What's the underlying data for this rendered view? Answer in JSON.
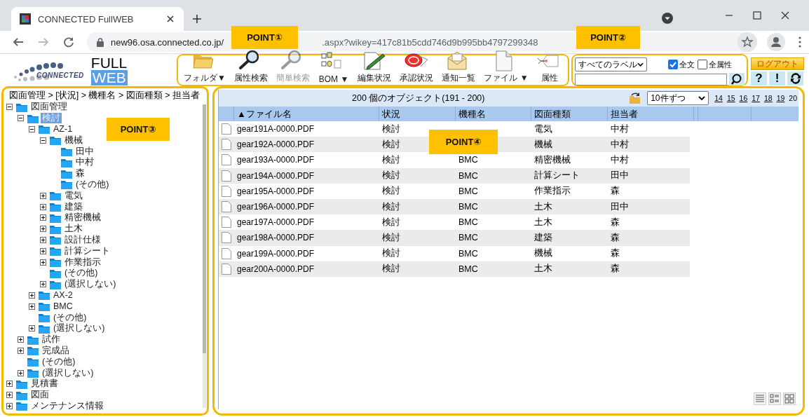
{
  "browser": {
    "tab_title": "CONNECTED FullWEB",
    "url_start": "new96.osa.connected.co.jp/",
    "url_end": ".aspx?wikey=417c81b5cdd746d9b995bb4797299348"
  },
  "callouts": [
    {
      "label": "POINT①",
      "kind": "toolbar"
    },
    {
      "label": "POINT②",
      "kind": "search"
    },
    {
      "label": "POINT③",
      "kind": "tree"
    },
    {
      "label": "POINT④",
      "kind": "list"
    }
  ],
  "logo": {
    "company": "CONNECTED",
    "product_top": "FULL",
    "product_bottom": "WEB"
  },
  "toolbar": [
    {
      "label": "フォルダ▼",
      "kind": "folder",
      "disabled": false
    },
    {
      "label": "属性検索",
      "kind": "magnifier",
      "disabled": false
    },
    {
      "label": "簡単検索",
      "kind": "magnifier",
      "disabled": true
    },
    {
      "label": "BOM ▼",
      "kind": "bom",
      "disabled": false
    },
    {
      "label": "編集状況",
      "kind": "pencil",
      "disabled": false
    },
    {
      "label": "承認状況",
      "kind": "stamp",
      "disabled": false
    },
    {
      "label": "通知一覧",
      "kind": "envelope",
      "disabled": false
    },
    {
      "label": "ファイル ▼",
      "kind": "document",
      "disabled": false
    },
    {
      "label": "属性",
      "kind": "tag",
      "disabled": false
    }
  ],
  "search": {
    "label_select": "すべてのラベル",
    "options": [
      {
        "label": "全文",
        "checked": true
      },
      {
        "label": "全属性",
        "checked": false
      }
    ]
  },
  "session": {
    "logout": "ログアウト",
    "help": "?",
    "notice": "!"
  },
  "tree": {
    "breadcrumb": "図面管理 > [状況] > 機種名 > 図面種類 > 担当者",
    "items": [
      {
        "kind": "folder",
        "label": "図面管理",
        "expanded": true,
        "selected": false,
        "children": [
          {
            "kind": "folder",
            "label": "検討",
            "expanded": true,
            "selected": true,
            "children": [
              {
                "kind": "folder",
                "label": "AZ-1",
                "expanded": true,
                "selected": false,
                "children": [
                  {
                    "kind": "folder",
                    "label": "機械",
                    "expanded": true,
                    "selected": false,
                    "children": [
                      {
                        "kind": "leaf",
                        "label": "田中",
                        "selected": false
                      },
                      {
                        "kind": "leaf",
                        "label": "中村",
                        "selected": false
                      },
                      {
                        "kind": "leaf",
                        "label": "森",
                        "selected": false
                      },
                      {
                        "kind": "leaf",
                        "label": "(その他)",
                        "selected": false
                      }
                    ]
                  },
                  {
                    "kind": "folder",
                    "label": "電気",
                    "expanded": false,
                    "selected": false
                  },
                  {
                    "kind": "folder",
                    "label": "建築",
                    "expanded": false,
                    "selected": false
                  },
                  {
                    "kind": "folder",
                    "label": "精密機械",
                    "expanded": false,
                    "selected": false
                  },
                  {
                    "kind": "folder",
                    "label": "土木",
                    "expanded": false,
                    "selected": false
                  },
                  {
                    "kind": "folder",
                    "label": "設計仕様",
                    "expanded": false,
                    "selected": false
                  },
                  {
                    "kind": "folder",
                    "label": "計算シート",
                    "expanded": false,
                    "selected": false
                  },
                  {
                    "kind": "folder",
                    "label": "作業指示",
                    "expanded": false,
                    "selected": false
                  },
                  {
                    "kind": "leaf",
                    "label": "(その他)",
                    "selected": false
                  },
                  {
                    "kind": "folder",
                    "label": "(選択しない)",
                    "expanded": false,
                    "selected": false
                  }
                ]
              },
              {
                "kind": "folder",
                "label": "AX-2",
                "expanded": false,
                "selected": false
              },
              {
                "kind": "folder",
                "label": "BMC",
                "expanded": false,
                "selected": false
              },
              {
                "kind": "leaf",
                "label": "(その他)",
                "selected": false
              },
              {
                "kind": "folder",
                "label": "(選択しない)",
                "expanded": false,
                "selected": false
              }
            ]
          },
          {
            "kind": "folder",
            "label": "試作",
            "expanded": false,
            "selected": false
          },
          {
            "kind": "folder",
            "label": "完成品",
            "expanded": false,
            "selected": false
          },
          {
            "kind": "leaf",
            "label": "(その他)",
            "selected": false
          },
          {
            "kind": "folder",
            "label": "(選択しない)",
            "expanded": false,
            "selected": false
          }
        ]
      },
      {
        "kind": "folder",
        "label": "見積書",
        "expanded": false,
        "selected": false
      },
      {
        "kind": "folder",
        "label": "図面",
        "expanded": false,
        "selected": false
      },
      {
        "kind": "folder",
        "label": "メンテナンス情報",
        "expanded": false,
        "selected": false
      }
    ]
  },
  "list": {
    "summary": "200 個のオブジェクト(191 - 200)",
    "page_size": "10件ずつ",
    "pages": [
      {
        "label": "14",
        "selected": false
      },
      {
        "label": "15",
        "selected": false
      },
      {
        "label": "16",
        "selected": false
      },
      {
        "label": "17",
        "selected": false
      },
      {
        "label": "18",
        "selected": false
      },
      {
        "label": "19",
        "selected": false
      },
      {
        "label": "20",
        "selected": true
      }
    ],
    "columns": [
      "▲ファイル名",
      "状況",
      "機種名",
      "図面種類",
      "担当者"
    ],
    "rows": [
      {
        "file": "gear191A-0000.PDF",
        "status": "検討",
        "type": "電気",
        "person": "中村"
      },
      {
        "file": "gear192A-0000.PDF",
        "status": "検討",
        "type": "機械",
        "person": "中村"
      },
      {
        "file": "gear193A-0000.PDF",
        "status": "検討",
        "model": "BMC",
        "type": "精密機械",
        "person": "中村"
      },
      {
        "file": "gear194A-0000.PDF",
        "status": "検討",
        "model": "BMC",
        "type": "計算シート",
        "person": "田中"
      },
      {
        "file": "gear195A-0000.PDF",
        "status": "検討",
        "model": "BMC",
        "type": "作業指示",
        "person": "森"
      },
      {
        "file": "gear196A-0000.PDF",
        "status": "検討",
        "model": "BMC",
        "type": "土木",
        "person": "田中"
      },
      {
        "file": "gear197A-0000.PDF",
        "status": "検討",
        "model": "BMC",
        "type": "土木",
        "person": "森"
      },
      {
        "file": "gear198A-0000.PDF",
        "status": "検討",
        "model": "BMC",
        "type": "建築",
        "person": "森"
      },
      {
        "file": "gear199A-0000.PDF",
        "status": "検討",
        "model": "BMC",
        "type": "機械",
        "person": "森"
      },
      {
        "file": "gear200A-0000.PDF",
        "status": "検討",
        "model": "BMC",
        "type": "土木",
        "person": "森"
      }
    ],
    "view_modes": [
      {
        "kind": "details"
      },
      {
        "kind": "list"
      },
      {
        "kind": "tiles"
      }
    ]
  }
}
